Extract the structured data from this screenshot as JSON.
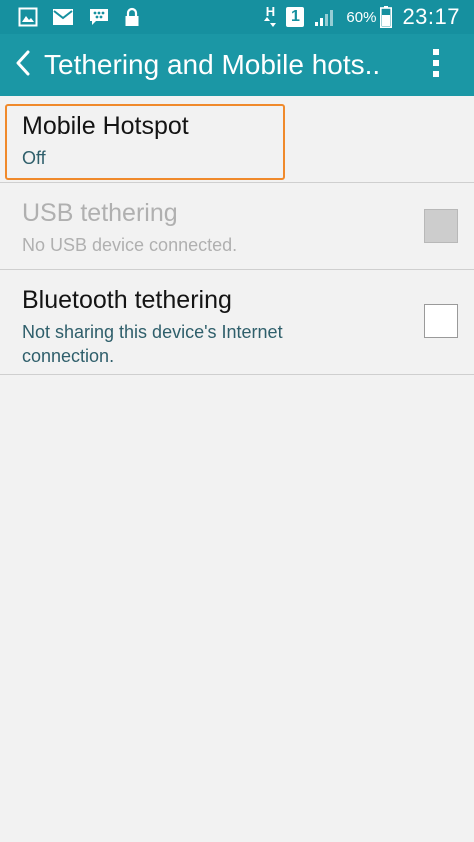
{
  "status_bar": {
    "icons": [
      "gallery-icon",
      "email-icon",
      "bbm-icon",
      "lock-icon"
    ],
    "network_type": "H",
    "sim_slot": "1",
    "battery_percent": "60%",
    "time": "23:17"
  },
  "action_bar": {
    "title": "Tethering and Mobile hots..",
    "back_icon": "chevron-left-icon",
    "overflow_icon": "more-vert-icon"
  },
  "items": [
    {
      "title": "Mobile Hotspot",
      "subtitle": "Off",
      "enabled": true,
      "highlighted": true
    },
    {
      "title": "USB tethering",
      "subtitle": "No USB device connected.",
      "enabled": false,
      "checked": false
    },
    {
      "title": "Bluetooth tethering",
      "subtitle": "Not sharing this device's Internet connection.",
      "enabled": true,
      "checked": false
    }
  ],
  "colors": {
    "status_bar": "#16909f",
    "action_bar": "#1b97a5",
    "highlight": "#f08a2c",
    "background": "#f2f2f2"
  }
}
